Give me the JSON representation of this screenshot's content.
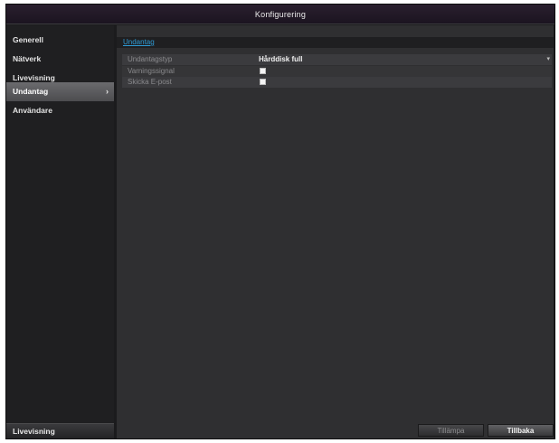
{
  "window": {
    "title": "Konfigurering"
  },
  "sidebar": {
    "items": [
      {
        "label": "Generell",
        "active": false
      },
      {
        "label": "Nätverk",
        "active": false
      },
      {
        "label": "Livevisning",
        "active": false
      },
      {
        "label": "Undantag",
        "active": true,
        "chevron": "›"
      },
      {
        "label": "Användare",
        "active": false
      }
    ],
    "bottom_label": "Livevisning"
  },
  "content": {
    "tab_label": "Undantag",
    "rows": [
      {
        "label": "Undantagstyp",
        "value": "Hårddisk full",
        "control": "dropdown",
        "arrow": "▾"
      },
      {
        "label": "Varningssignal",
        "control": "checkbox",
        "checked": false
      },
      {
        "label": "Skicka E-post",
        "control": "checkbox",
        "checked": false
      }
    ]
  },
  "buttons": {
    "apply": "Tillämpa",
    "back": "Tillbaka"
  }
}
